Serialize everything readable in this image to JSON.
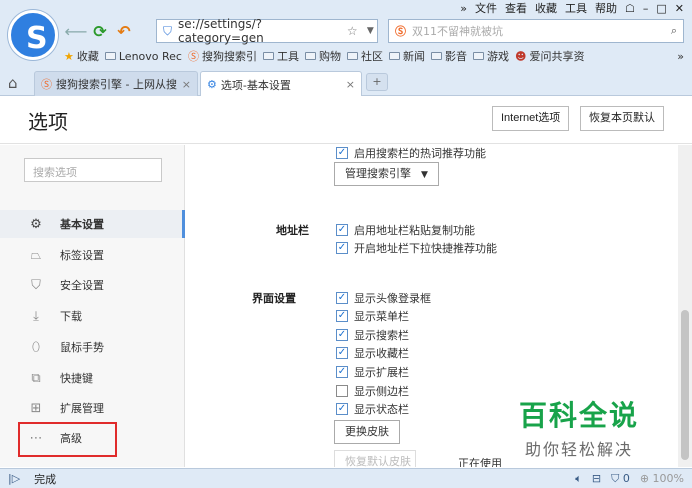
{
  "topmenu": [
    "»",
    "文件",
    "查看",
    "收藏",
    "工具",
    "帮助",
    "☖",
    "–",
    "□",
    "✕"
  ],
  "address": {
    "url": "se://settings/?category=gen"
  },
  "search": {
    "placeholder": "双11不留神就被坑"
  },
  "bookmarks": {
    "items": [
      {
        "icon": "star-icon",
        "label": "收藏"
      },
      {
        "icon": "folder-icon",
        "label": "Lenovo Rec"
      },
      {
        "icon": "sogou-icon",
        "label": "搜狗搜索引"
      },
      {
        "icon": "folder-icon",
        "label": "工具"
      },
      {
        "icon": "folder-icon",
        "label": "购物"
      },
      {
        "icon": "folder-icon",
        "label": "社区"
      },
      {
        "icon": "folder-icon",
        "label": "新闻"
      },
      {
        "icon": "folder-icon",
        "label": "影音"
      },
      {
        "icon": "folder-icon",
        "label": "游戏"
      },
      {
        "icon": "user-icon",
        "label": "爱问共享资"
      }
    ],
    "more": "»"
  },
  "tabs": [
    {
      "label": "搜狗搜索引擎 - 上网从搜",
      "active": false
    },
    {
      "label": "选项-基本设置",
      "active": true
    }
  ],
  "header": {
    "title": "选项",
    "internet_btn": "Internet选项",
    "restore_btn": "恢复本页默认"
  },
  "sidebar": {
    "search_placeholder": "搜索选项",
    "items": [
      {
        "icon": "gear-icon",
        "label": "基本设置",
        "active": true
      },
      {
        "icon": "tab-icon",
        "label": "标签设置"
      },
      {
        "icon": "shield-icon",
        "label": "安全设置"
      },
      {
        "icon": "download-icon",
        "label": "下载"
      },
      {
        "icon": "mouse-icon",
        "label": "鼠标手势"
      },
      {
        "icon": "shortcut-icon",
        "label": "快捷键"
      },
      {
        "icon": "extension-icon",
        "label": "扩展管理"
      },
      {
        "icon": "more-icon",
        "label": "高级"
      }
    ]
  },
  "content": {
    "search_bar_hotwords": "启用搜索栏的热词推荐功能",
    "manage_engines_btn": "管理搜索引擎",
    "address_bar": {
      "label": "地址栏",
      "options": [
        {
          "label": "启用地址栏粘贴复制功能",
          "checked": true
        },
        {
          "label": "开启地址栏下拉快捷推荐功能",
          "checked": true
        }
      ]
    },
    "ui_settings": {
      "label": "界面设置",
      "options": [
        {
          "label": "显示头像登录框",
          "checked": true
        },
        {
          "label": "显示菜单栏",
          "checked": true
        },
        {
          "label": "显示搜索栏",
          "checked": true
        },
        {
          "label": "显示收藏栏",
          "checked": true
        },
        {
          "label": "显示扩展栏",
          "checked": true
        },
        {
          "label": "显示侧边栏",
          "checked": false
        },
        {
          "label": "显示状态栏",
          "checked": true
        }
      ],
      "change_skin_btn": "更换皮肤",
      "restore_skin_btn": "恢复默认皮肤",
      "in_use_text": "正在使用"
    }
  },
  "watermark": {
    "line1": "百科全说",
    "line2": "助你轻松解决"
  },
  "statusbar": {
    "status": "完成",
    "counter": "0",
    "zoom": "100%"
  }
}
